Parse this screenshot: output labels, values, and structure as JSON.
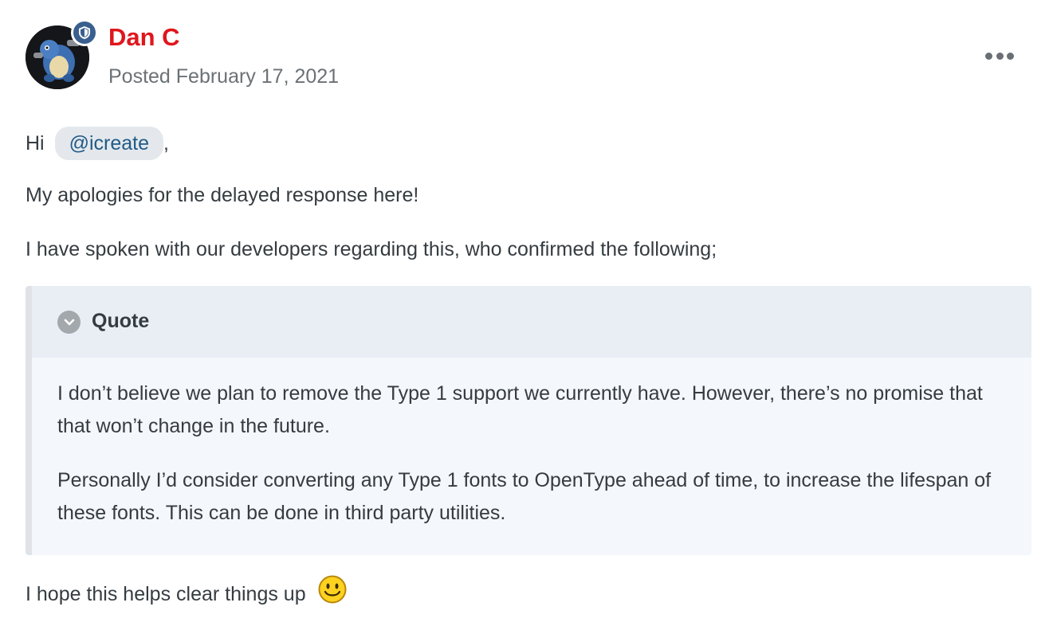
{
  "post": {
    "author": {
      "name": "Dan C",
      "avatar_icon": "avatar-image",
      "badge_icon": "moderator-shield-icon"
    },
    "date_label": "Posted February 17, 2021",
    "more_icon": "ellipsis-icon",
    "body": {
      "greeting_prefix": "Hi",
      "mention": "@icreate",
      "greeting_suffix": ",",
      "paragraph_1": "My apologies for the delayed response here!",
      "paragraph_2": "I have spoken with our developers regarding this, who confirmed the following;",
      "quote": {
        "title": "Quote",
        "toggle_icon": "chevron-down-icon",
        "paragraph_1": "I don’t believe we plan to remove the Type 1 support we currently have. However, there’s no promise that that won’t change in the future.",
        "paragraph_2": "Personally I’d consider converting any Type 1 fonts to OpenType ahead of time, to increase the lifespan of these fonts. This can be done in third party utilities."
      },
      "closing": "I hope this helps clear things up",
      "closing_emoji": "smiley-emoji-icon"
    }
  },
  "colors": {
    "author_name": "#e0161d",
    "mention_bg": "#e4e8ec",
    "mention_text": "#205a88",
    "quote_bg": "#f4f7fb",
    "quote_header_bg": "#e9eef5",
    "badge": "#3a5f8f"
  }
}
